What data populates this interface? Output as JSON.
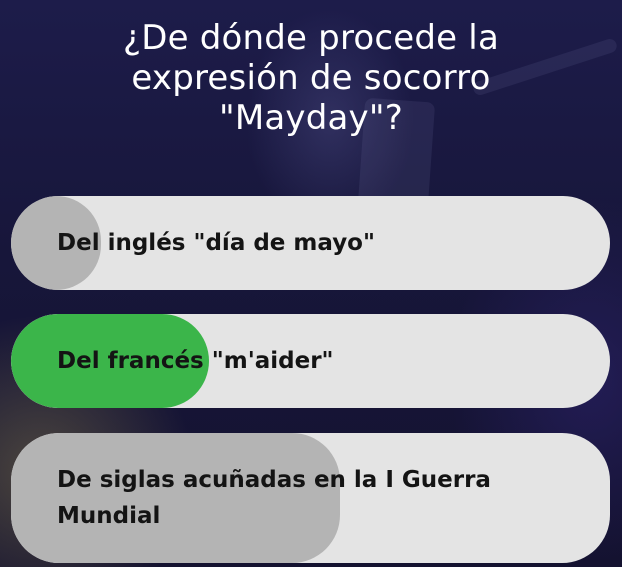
{
  "question": {
    "text": "¿De dónde procede la\nexpresión de socorro\n\"Mayday\"?"
  },
  "answers": [
    {
      "text": "Del inglés \"día de mayo\"",
      "fill_fraction": 0.15,
      "state": "neutral"
    },
    {
      "text": "Del francés \"m'aider\"",
      "fill_fraction": 0.33,
      "state": "correct"
    },
    {
      "text": "De siglas acuñadas en la I Guerra\nMundial",
      "fill_fraction": 0.55,
      "state": "neutral"
    }
  ],
  "colors": {
    "answer_background": "#e4e4e4",
    "neutral_fill": "#b4b4b4",
    "correct_fill": "#3bb54a",
    "question_text": "#ffffff",
    "answer_text": "#141414"
  }
}
